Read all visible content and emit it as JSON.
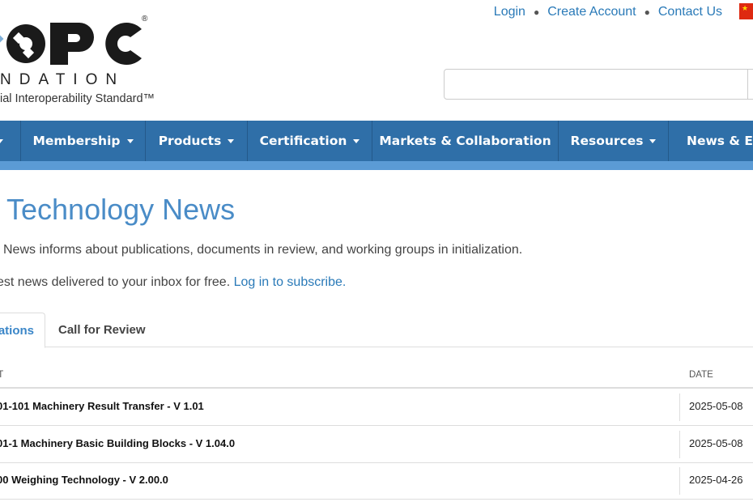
{
  "header": {
    "logo": {
      "wordmark": "OPC",
      "foundation": "NDATION",
      "tagline": "ial Interoperability Standard™",
      "registered": "®"
    },
    "top_links": [
      {
        "label": "Login"
      },
      {
        "label": "Create Account"
      },
      {
        "label": "Contact Us"
      }
    ],
    "flag_icon": "china-flag-icon",
    "search": {
      "placeholder": "",
      "value": ""
    }
  },
  "nav": {
    "items": [
      {
        "label": "",
        "dropdown": true
      },
      {
        "label": "Membership",
        "dropdown": true
      },
      {
        "label": "Products",
        "dropdown": true
      },
      {
        "label": "Certification",
        "dropdown": true
      },
      {
        "label": "Markets & Collaboration",
        "dropdown": false
      },
      {
        "label": "Resources",
        "dropdown": true
      },
      {
        "label": "News & Eve",
        "dropdown": false
      }
    ],
    "colors": {
      "bar": "#2f6fa8",
      "strip": "#5b9bd5"
    }
  },
  "main": {
    "title": "Technology News",
    "intro": "News informs about publications, documents in review, and working groups in initialization.",
    "subscribe_prefix": "est news delivered to your inbox for free. ",
    "subscribe_link": "Log in to subscribe.",
    "tabs": [
      {
        "label": "ations",
        "active": true
      },
      {
        "label": "Call for Review",
        "active": false
      }
    ],
    "table": {
      "columns": [
        "IT",
        "DATE"
      ],
      "rows": [
        {
          "title": "01-101 Machinery Result Transfer - V 1.01",
          "date": "2025-05-08"
        },
        {
          "title": "01-1 Machinery Basic Building Blocks - V 1.04.0",
          "date": "2025-05-08"
        },
        {
          "title": "00 Weighing Technology - V 2.00.0",
          "date": "2025-04-26"
        }
      ]
    }
  }
}
